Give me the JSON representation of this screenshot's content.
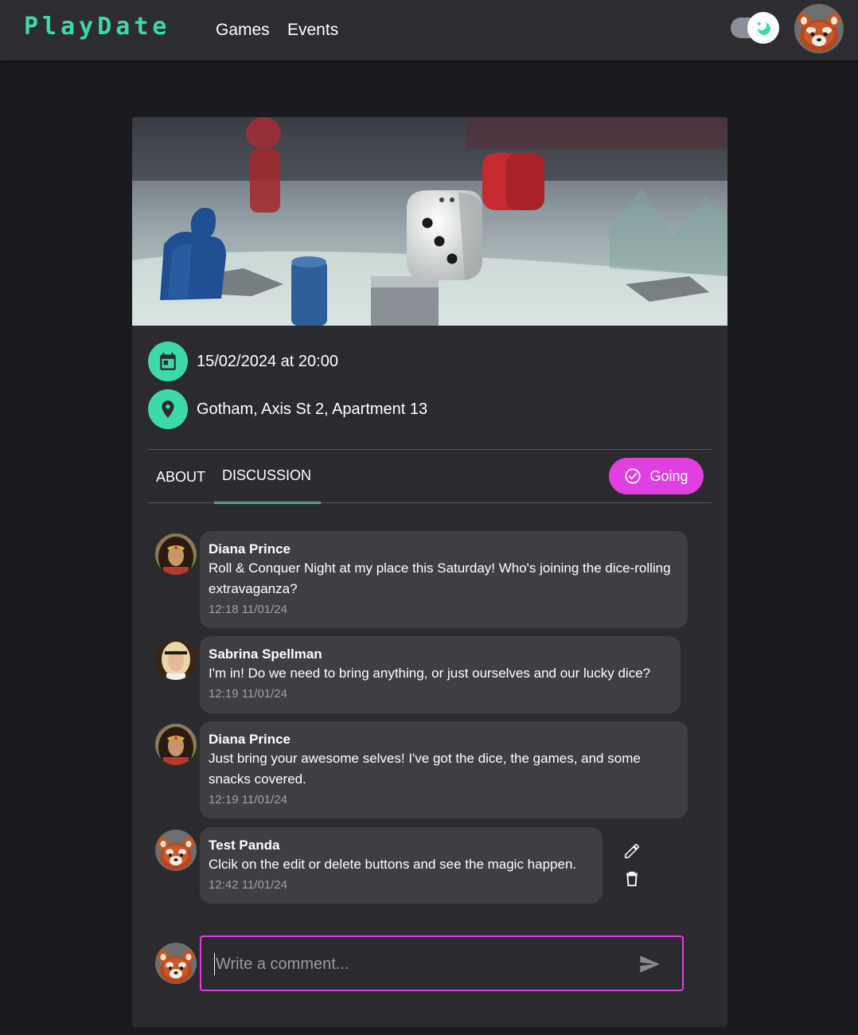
{
  "navbar": {
    "logo": "PlayDate",
    "links": [
      "Games",
      "Events"
    ],
    "avatar_icon": "red-panda-avatar",
    "theme_toggle_icon": "moon-icon"
  },
  "event": {
    "hero_icon": "board-game-dice-image",
    "date": "15/02/2024 at 20:00",
    "location": "Gotham, Axis St 2, Apartment 13",
    "tabs": [
      "ABOUT",
      "DISCUSSION"
    ],
    "active_tab": "DISCUSSION",
    "going_label": "Going"
  },
  "comments": [
    {
      "author": "Diana Prince",
      "text": "Roll & Conquer Night at my place this Saturday! Who's joining the dice-rolling extravaganza?",
      "time": "12:18 11/01/24"
    },
    {
      "author": "Sabrina Spellman",
      "text": "I'm in! Do we need to bring anything, or just ourselves and our lucky dice?",
      "time": "12:19 11/01/24"
    },
    {
      "author": "Diana Prince",
      "text": "Just bring your awesome selves! I've got the dice, the games, and some snacks covered.",
      "time": "12:19 11/01/24"
    },
    {
      "author": "Test Panda",
      "text": "Clcik on the edit or delete buttons and see the magic happen.",
      "time": "12:42 11/01/24"
    }
  ],
  "compose": {
    "placeholder": "Write a comment...",
    "value": ""
  },
  "colors": {
    "accent": "#3dd9a8",
    "primary": "#e040e0",
    "background": "#1b1b1f",
    "card": "#2b2a2e",
    "bubble": "#3f3e43"
  }
}
